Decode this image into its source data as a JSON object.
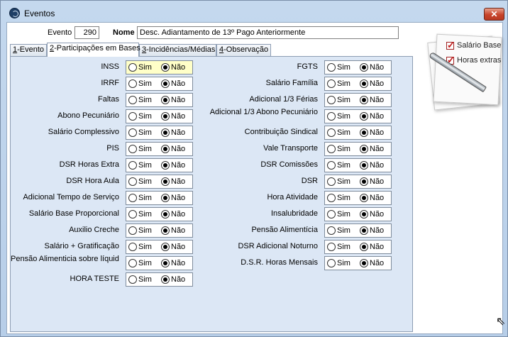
{
  "window": {
    "title": "Eventos",
    "close_glyph": "✕"
  },
  "header": {
    "evento_label": "Evento",
    "evento_value": "290",
    "nome_label": "Nome",
    "nome_value": "Desc.  Adiantamento de 13º Pago Anteriormente"
  },
  "tabs": [
    {
      "key": "1",
      "rest": "-Evento",
      "active": false
    },
    {
      "key": "2",
      "rest": "-Participações em Bases",
      "active": true
    },
    {
      "key": "3",
      "rest": "-Incidências/Médias",
      "active": false
    },
    {
      "key": "4",
      "rest": "-Observação",
      "active": false
    }
  ],
  "options": {
    "sim": "Sim",
    "nao": "Não"
  },
  "left_rows": [
    {
      "label": "INSS",
      "selected": "nao",
      "highlight": true
    },
    {
      "label": "IRRF",
      "selected": "nao"
    },
    {
      "label": "Faltas",
      "selected": "nao"
    },
    {
      "label": "Abono Pecuniário",
      "selected": "nao"
    },
    {
      "label": "Salário Complessivo",
      "selected": "nao"
    },
    {
      "label": "PIS",
      "selected": "nao"
    },
    {
      "label": "DSR Horas Extra",
      "selected": "nao"
    },
    {
      "label": "DSR Hora Aula",
      "selected": "nao"
    },
    {
      "label": "Adicional Tempo de Serviço",
      "selected": "nao"
    },
    {
      "label": "Salário Base Proporcional",
      "selected": "nao"
    },
    {
      "label": "Auxilio Creche",
      "selected": "nao"
    },
    {
      "label": "Salário + Gratificação",
      "selected": "nao"
    },
    {
      "label": "Pensão Alimenticia sobre líquidos",
      "selected": "nao"
    },
    {
      "label": "HORA TESTE",
      "selected": "nao"
    }
  ],
  "right_rows": [
    {
      "label": "FGTS",
      "selected": "nao"
    },
    {
      "label": "Salário Família",
      "selected": "nao"
    },
    {
      "label": "Adicional 1/3 Férias",
      "selected": "nao"
    },
    {
      "label": "Adicional 1/3 Abono Pecuniário",
      "selected": "nao"
    },
    {
      "label": "Contribuição Sindical",
      "selected": "nao"
    },
    {
      "label": "Vale Transporte",
      "selected": "nao"
    },
    {
      "label": "DSR Comissões",
      "selected": "nao"
    },
    {
      "label": "DSR",
      "selected": "nao"
    },
    {
      "label": "Hora Atividade",
      "selected": "nao"
    },
    {
      "label": "Insalubridade",
      "selected": "nao"
    },
    {
      "label": "Pensão Alimentícia",
      "selected": "nao"
    },
    {
      "label": "DSR Adicional Noturno",
      "selected": "nao"
    },
    {
      "label": "D.S.R. Horas Mensais",
      "selected": "nao"
    }
  ],
  "note": {
    "icon": "checklist-note-icon",
    "items": [
      {
        "label": "Salário Base",
        "checked": true
      },
      {
        "label": "Horas extras",
        "checked": true
      }
    ]
  }
}
